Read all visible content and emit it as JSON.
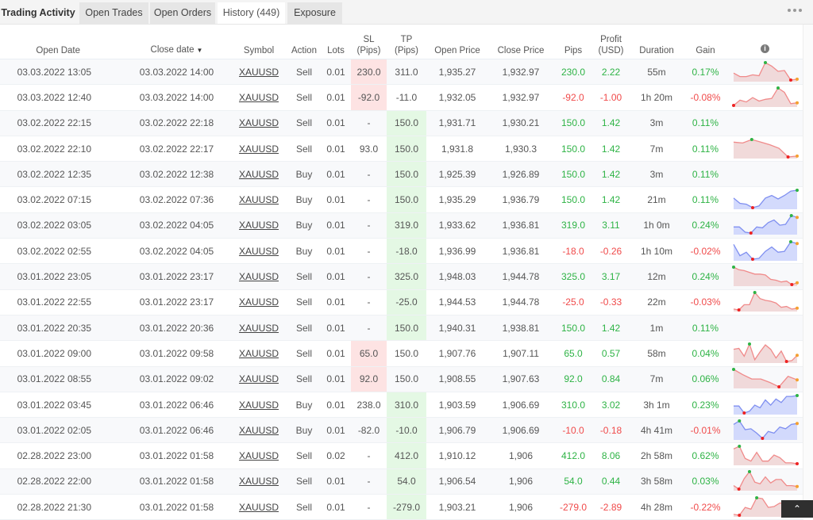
{
  "tabs": {
    "title": "Trading Activity",
    "items": [
      {
        "label": "Open Trades"
      },
      {
        "label": "Open Orders"
      },
      {
        "label": "History (449)"
      },
      {
        "label": "Exposure"
      }
    ],
    "active": "History (449)"
  },
  "columns": {
    "open_date": "Open Date",
    "close_date": "Close date",
    "sort_indicator": "▼",
    "symbol": "Symbol",
    "action": "Action",
    "lots": "Lots",
    "sl_1": "SL",
    "sl_2": "(Pips)",
    "tp_1": "TP",
    "tp_2": "(Pips)",
    "open_price": "Open Price",
    "close_price": "Close Price",
    "pips": "Pips",
    "profit_1": "Profit",
    "profit_2": "(USD)",
    "duration": "Duration",
    "gain": "Gain",
    "info_icon": "i"
  },
  "colors": {
    "positive": "#2eb345",
    "negative": "#f04a4a",
    "sell_line": "#f08a8a",
    "sell_fill": "#efd3d3",
    "buy_line": "#7f8ff0",
    "buy_fill": "#cbd4fb",
    "max_dot": "#2eb345",
    "min_dot": "#ee2222",
    "end_dot": "#f5a030"
  },
  "rows": [
    {
      "open_date": "03.03.2022 13:05",
      "close_date": "03.03.2022 14:00",
      "symbol": "XAUUSD",
      "action": "Sell",
      "lots": "0.01",
      "sl": "230.0",
      "sl_hit": true,
      "tp": "311.0",
      "tp_hit": false,
      "open_price": "1,935.27",
      "close_price": "1,932.97",
      "pips": "230.0",
      "profit": "2.22",
      "duration": "55m",
      "gain": "0.17%",
      "positive": true,
      "spark": [
        0.4,
        0.2,
        0.2,
        0.3,
        0.25,
        1.0,
        0.8,
        0.5,
        0.55,
        0.0,
        0.05
      ]
    },
    {
      "open_date": "03.03.2022 12:40",
      "close_date": "03.03.2022 14:00",
      "symbol": "XAUUSD",
      "action": "Sell",
      "lots": "0.01",
      "sl": "-92.0",
      "sl_hit": true,
      "tp": "-11.0",
      "tp_hit": false,
      "open_price": "1,932.05",
      "close_price": "1,932.97",
      "pips": "-92.0",
      "profit": "-1.00",
      "duration": "1h 20m",
      "gain": "-0.08%",
      "positive": false,
      "spark": [
        0.0,
        0.3,
        0.2,
        0.45,
        0.25,
        0.35,
        0.4,
        1.0,
        0.75,
        0.1,
        0.15
      ]
    },
    {
      "open_date": "03.02.2022 22:15",
      "close_date": "03.02.2022 22:18",
      "symbol": "XAUUSD",
      "action": "Sell",
      "lots": "0.01",
      "sl": "-",
      "sl_hit": false,
      "tp": "150.0",
      "tp_hit": true,
      "open_price": "1,931.71",
      "close_price": "1,930.21",
      "pips": "150.0",
      "profit": "1.42",
      "duration": "3m",
      "gain": "0.11%",
      "positive": true,
      "spark": []
    },
    {
      "open_date": "03.02.2022 22:10",
      "close_date": "03.02.2022 22:17",
      "symbol": "XAUUSD",
      "action": "Sell",
      "lots": "0.01",
      "sl": "93.0",
      "sl_hit": false,
      "tp": "150.0",
      "tp_hit": true,
      "open_price": "1,931.8",
      "close_price": "1,930.3",
      "pips": "150.0",
      "profit": "1.42",
      "duration": "7m",
      "gain": "0.11%",
      "positive": true,
      "spark": [
        0.85,
        0.8,
        1.0,
        0.85,
        0.7,
        0.5,
        0.0,
        0.05
      ]
    },
    {
      "open_date": "03.02.2022 12:35",
      "close_date": "03.02.2022 12:38",
      "symbol": "XAUUSD",
      "action": "Buy",
      "lots": "0.01",
      "sl": "-",
      "sl_hit": false,
      "tp": "150.0",
      "tp_hit": true,
      "open_price": "1,925.39",
      "close_price": "1,926.89",
      "pips": "150.0",
      "profit": "1.42",
      "duration": "3m",
      "gain": "0.11%",
      "positive": true,
      "spark": []
    },
    {
      "open_date": "03.02.2022 07:15",
      "close_date": "03.02.2022 07:36",
      "symbol": "XAUUSD",
      "action": "Buy",
      "lots": "0.01",
      "sl": "-",
      "sl_hit": false,
      "tp": "150.0",
      "tp_hit": true,
      "open_price": "1,935.29",
      "close_price": "1,936.79",
      "pips": "150.0",
      "profit": "1.42",
      "duration": "21m",
      "gain": "0.11%",
      "positive": true,
      "spark": [
        0.55,
        0.25,
        0.2,
        0.0,
        0.1,
        0.55,
        0.7,
        0.5,
        0.7,
        0.95,
        1.0
      ]
    },
    {
      "open_date": "03.02.2022 03:05",
      "close_date": "03.02.2022 04:05",
      "symbol": "XAUUSD",
      "action": "Buy",
      "lots": "0.01",
      "sl": "-",
      "sl_hit": false,
      "tp": "319.0",
      "tp_hit": true,
      "open_price": "1,933.62",
      "close_price": "1,936.81",
      "pips": "319.0",
      "profit": "3.11",
      "duration": "1h 0m",
      "gain": "0.24%",
      "positive": true,
      "spark": [
        0.35,
        0.35,
        0.05,
        0.0,
        0.35,
        0.3,
        0.6,
        0.75,
        0.45,
        0.5,
        1.0,
        0.9
      ]
    },
    {
      "open_date": "03.02.2022 02:55",
      "close_date": "03.02.2022 04:05",
      "symbol": "XAUUSD",
      "action": "Buy",
      "lots": "0.01",
      "sl": "-",
      "sl_hit": false,
      "tp": "-18.0",
      "tp_hit": true,
      "open_price": "1,936.99",
      "close_price": "1,936.81",
      "pips": "-18.0",
      "profit": "-0.26",
      "duration": "1h 10m",
      "gain": "-0.02%",
      "positive": false,
      "spark": [
        0.85,
        0.2,
        0.4,
        0.0,
        0.05,
        0.45,
        0.7,
        0.4,
        0.45,
        1.0,
        0.9
      ]
    },
    {
      "open_date": "03.01.2022 23:05",
      "close_date": "03.01.2022 23:17",
      "symbol": "XAUUSD",
      "action": "Sell",
      "lots": "0.01",
      "sl": "-",
      "sl_hit": false,
      "tp": "325.0",
      "tp_hit": true,
      "open_price": "1,948.03",
      "close_price": "1,944.78",
      "pips": "325.0",
      "profit": "3.17",
      "duration": "12m",
      "gain": "0.24%",
      "positive": true,
      "spark": [
        1.0,
        0.85,
        0.8,
        0.7,
        0.6,
        0.6,
        0.55,
        0.3,
        0.25,
        0.15,
        0.2,
        0.0,
        0.1
      ]
    },
    {
      "open_date": "03.01.2022 22:55",
      "close_date": "03.01.2022 23:17",
      "symbol": "XAUUSD",
      "action": "Sell",
      "lots": "0.01",
      "sl": "-",
      "sl_hit": false,
      "tp": "-25.0",
      "tp_hit": true,
      "open_price": "1,944.53",
      "close_price": "1,944.78",
      "pips": "-25.0",
      "profit": "-0.33",
      "duration": "22m",
      "gain": "-0.03%",
      "positive": false,
      "spark": [
        0.05,
        0.0,
        0.3,
        0.3,
        1.0,
        0.65,
        0.55,
        0.5,
        0.4,
        0.15,
        0.2,
        0.05,
        0.1
      ]
    },
    {
      "open_date": "03.01.2022 20:35",
      "close_date": "03.01.2022 20:36",
      "symbol": "XAUUSD",
      "action": "Sell",
      "lots": "0.01",
      "sl": "-",
      "sl_hit": false,
      "tp": "150.0",
      "tp_hit": true,
      "open_price": "1,940.31",
      "close_price": "1,938.81",
      "pips": "150.0",
      "profit": "1.42",
      "duration": "1m",
      "gain": "0.11%",
      "positive": true,
      "spark": []
    },
    {
      "open_date": "03.01.2022 09:00",
      "close_date": "03.01.2022 09:58",
      "symbol": "XAUUSD",
      "action": "Sell",
      "lots": "0.01",
      "sl": "65.0",
      "sl_hit": true,
      "tp": "150.0",
      "tp_hit": false,
      "open_price": "1,907.76",
      "close_price": "1,907.11",
      "pips": "65.0",
      "profit": "0.57",
      "duration": "58m",
      "gain": "0.04%",
      "positive": true,
      "spark": [
        0.7,
        0.75,
        0.3,
        1.0,
        0.1,
        0.55,
        0.95,
        0.7,
        0.2,
        0.6,
        0.0,
        0.05,
        0.35
      ]
    },
    {
      "open_date": "03.01.2022 08:55",
      "close_date": "03.01.2022 09:02",
      "symbol": "XAUUSD",
      "action": "Sell",
      "lots": "0.01",
      "sl": "92.0",
      "sl_hit": true,
      "tp": "150.0",
      "tp_hit": false,
      "open_price": "1,908.55",
      "close_price": "1,907.63",
      "pips": "92.0",
      "profit": "0.84",
      "duration": "7m",
      "gain": "0.06%",
      "positive": true,
      "spark": [
        1.0,
        0.7,
        0.45,
        0.45,
        0.25,
        0.0,
        0.6,
        0.4
      ]
    },
    {
      "open_date": "03.01.2022 03:45",
      "close_date": "03.01.2022 06:46",
      "symbol": "XAUUSD",
      "action": "Buy",
      "lots": "0.01",
      "sl": "238.0",
      "sl_hit": false,
      "tp": "310.0",
      "tp_hit": true,
      "open_price": "1,903.59",
      "close_price": "1,906.69",
      "pips": "310.0",
      "profit": "3.02",
      "duration": "3h 1m",
      "gain": "0.23%",
      "positive": true,
      "spark": [
        0.4,
        0.4,
        0.0,
        0.1,
        0.45,
        0.3,
        0.75,
        0.45,
        0.8,
        0.6,
        0.95,
        0.95,
        1.0
      ]
    },
    {
      "open_date": "03.01.2022 02:05",
      "close_date": "03.01.2022 06:46",
      "symbol": "XAUUSD",
      "action": "Buy",
      "lots": "0.01",
      "sl": "-82.0",
      "sl_hit": false,
      "tp": "-10.0",
      "tp_hit": true,
      "open_price": "1,906.79",
      "close_price": "1,906.69",
      "pips": "-10.0",
      "profit": "-0.18",
      "duration": "4h 41m",
      "gain": "-0.01%",
      "positive": false,
      "spark": [
        0.8,
        1.0,
        0.5,
        0.55,
        0.3,
        0.0,
        0.4,
        0.3,
        0.65,
        0.55,
        0.8,
        0.85
      ]
    },
    {
      "open_date": "02.28.2022 23:00",
      "close_date": "03.01.2022 01:58",
      "symbol": "XAUUSD",
      "action": "Sell",
      "lots": "0.02",
      "sl": "-",
      "sl_hit": false,
      "tp": "412.0",
      "tp_hit": true,
      "open_price": "1,910.12",
      "close_price": "1,906",
      "pips": "412.0",
      "profit": "8.06",
      "duration": "2h 58m",
      "gain": "0.62%",
      "positive": true,
      "spark": [
        0.85,
        1.0,
        0.3,
        0.15,
        0.65,
        0.15,
        0.15,
        0.5,
        0.35,
        0.05,
        0.05,
        0.0
      ]
    },
    {
      "open_date": "02.28.2022 22:00",
      "close_date": "03.01.2022 01:58",
      "symbol": "XAUUSD",
      "action": "Sell",
      "lots": "0.01",
      "sl": "-",
      "sl_hit": false,
      "tp": "54.0",
      "tp_hit": true,
      "open_price": "1,906.54",
      "close_price": "1,906",
      "pips": "54.0",
      "profit": "0.44",
      "duration": "3h 58m",
      "gain": "0.03%",
      "positive": true,
      "spark": [
        0.2,
        0.0,
        0.6,
        1.0,
        0.4,
        0.3,
        0.7,
        0.35,
        0.55,
        0.55,
        0.2,
        0.2,
        0.15
      ]
    },
    {
      "open_date": "02.28.2022 21:30",
      "close_date": "03.01.2022 01:58",
      "symbol": "XAUUSD",
      "action": "Sell",
      "lots": "0.01",
      "sl": "-",
      "sl_hit": false,
      "tp": "-279.0",
      "tp_hit": true,
      "open_price": "1,903.21",
      "close_price": "1,906",
      "pips": "-279.0",
      "profit": "-2.89",
      "duration": "4h 28m",
      "gain": "-0.22%",
      "positive": false,
      "spark": [
        0.05,
        0.0,
        0.45,
        0.35,
        1.0,
        0.95,
        0.45,
        0.5,
        0.7,
        0.7,
        0.45,
        0.4
      ]
    }
  ],
  "scroll_top_label": "⌃"
}
